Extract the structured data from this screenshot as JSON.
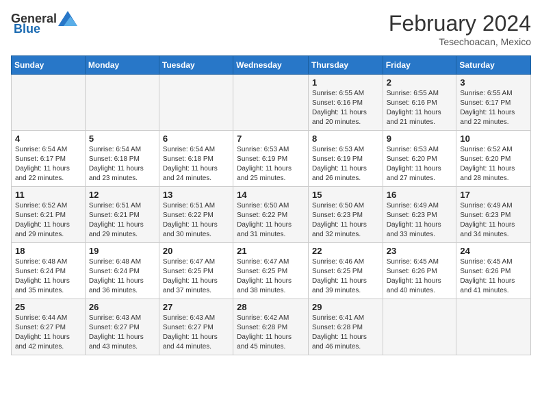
{
  "header": {
    "logo_general": "General",
    "logo_blue": "Blue",
    "month_year": "February 2024",
    "location": "Tesechoacan, Mexico"
  },
  "days_of_week": [
    "Sunday",
    "Monday",
    "Tuesday",
    "Wednesday",
    "Thursday",
    "Friday",
    "Saturday"
  ],
  "weeks": [
    [
      {
        "day": "",
        "info": ""
      },
      {
        "day": "",
        "info": ""
      },
      {
        "day": "",
        "info": ""
      },
      {
        "day": "",
        "info": ""
      },
      {
        "day": "1",
        "info": "Sunrise: 6:55 AM\nSunset: 6:16 PM\nDaylight: 11 hours and 20 minutes."
      },
      {
        "day": "2",
        "info": "Sunrise: 6:55 AM\nSunset: 6:16 PM\nDaylight: 11 hours and 21 minutes."
      },
      {
        "day": "3",
        "info": "Sunrise: 6:55 AM\nSunset: 6:17 PM\nDaylight: 11 hours and 22 minutes."
      }
    ],
    [
      {
        "day": "4",
        "info": "Sunrise: 6:54 AM\nSunset: 6:17 PM\nDaylight: 11 hours and 22 minutes."
      },
      {
        "day": "5",
        "info": "Sunrise: 6:54 AM\nSunset: 6:18 PM\nDaylight: 11 hours and 23 minutes."
      },
      {
        "day": "6",
        "info": "Sunrise: 6:54 AM\nSunset: 6:18 PM\nDaylight: 11 hours and 24 minutes."
      },
      {
        "day": "7",
        "info": "Sunrise: 6:53 AM\nSunset: 6:19 PM\nDaylight: 11 hours and 25 minutes."
      },
      {
        "day": "8",
        "info": "Sunrise: 6:53 AM\nSunset: 6:19 PM\nDaylight: 11 hours and 26 minutes."
      },
      {
        "day": "9",
        "info": "Sunrise: 6:53 AM\nSunset: 6:20 PM\nDaylight: 11 hours and 27 minutes."
      },
      {
        "day": "10",
        "info": "Sunrise: 6:52 AM\nSunset: 6:20 PM\nDaylight: 11 hours and 28 minutes."
      }
    ],
    [
      {
        "day": "11",
        "info": "Sunrise: 6:52 AM\nSunset: 6:21 PM\nDaylight: 11 hours and 29 minutes."
      },
      {
        "day": "12",
        "info": "Sunrise: 6:51 AM\nSunset: 6:21 PM\nDaylight: 11 hours and 29 minutes."
      },
      {
        "day": "13",
        "info": "Sunrise: 6:51 AM\nSunset: 6:22 PM\nDaylight: 11 hours and 30 minutes."
      },
      {
        "day": "14",
        "info": "Sunrise: 6:50 AM\nSunset: 6:22 PM\nDaylight: 11 hours and 31 minutes."
      },
      {
        "day": "15",
        "info": "Sunrise: 6:50 AM\nSunset: 6:23 PM\nDaylight: 11 hours and 32 minutes."
      },
      {
        "day": "16",
        "info": "Sunrise: 6:49 AM\nSunset: 6:23 PM\nDaylight: 11 hours and 33 minutes."
      },
      {
        "day": "17",
        "info": "Sunrise: 6:49 AM\nSunset: 6:23 PM\nDaylight: 11 hours and 34 minutes."
      }
    ],
    [
      {
        "day": "18",
        "info": "Sunrise: 6:48 AM\nSunset: 6:24 PM\nDaylight: 11 hours and 35 minutes."
      },
      {
        "day": "19",
        "info": "Sunrise: 6:48 AM\nSunset: 6:24 PM\nDaylight: 11 hours and 36 minutes."
      },
      {
        "day": "20",
        "info": "Sunrise: 6:47 AM\nSunset: 6:25 PM\nDaylight: 11 hours and 37 minutes."
      },
      {
        "day": "21",
        "info": "Sunrise: 6:47 AM\nSunset: 6:25 PM\nDaylight: 11 hours and 38 minutes."
      },
      {
        "day": "22",
        "info": "Sunrise: 6:46 AM\nSunset: 6:25 PM\nDaylight: 11 hours and 39 minutes."
      },
      {
        "day": "23",
        "info": "Sunrise: 6:45 AM\nSunset: 6:26 PM\nDaylight: 11 hours and 40 minutes."
      },
      {
        "day": "24",
        "info": "Sunrise: 6:45 AM\nSunset: 6:26 PM\nDaylight: 11 hours and 41 minutes."
      }
    ],
    [
      {
        "day": "25",
        "info": "Sunrise: 6:44 AM\nSunset: 6:27 PM\nDaylight: 11 hours and 42 minutes."
      },
      {
        "day": "26",
        "info": "Sunrise: 6:43 AM\nSunset: 6:27 PM\nDaylight: 11 hours and 43 minutes."
      },
      {
        "day": "27",
        "info": "Sunrise: 6:43 AM\nSunset: 6:27 PM\nDaylight: 11 hours and 44 minutes."
      },
      {
        "day": "28",
        "info": "Sunrise: 6:42 AM\nSunset: 6:28 PM\nDaylight: 11 hours and 45 minutes."
      },
      {
        "day": "29",
        "info": "Sunrise: 6:41 AM\nSunset: 6:28 PM\nDaylight: 11 hours and 46 minutes."
      },
      {
        "day": "",
        "info": ""
      },
      {
        "day": "",
        "info": ""
      }
    ]
  ]
}
